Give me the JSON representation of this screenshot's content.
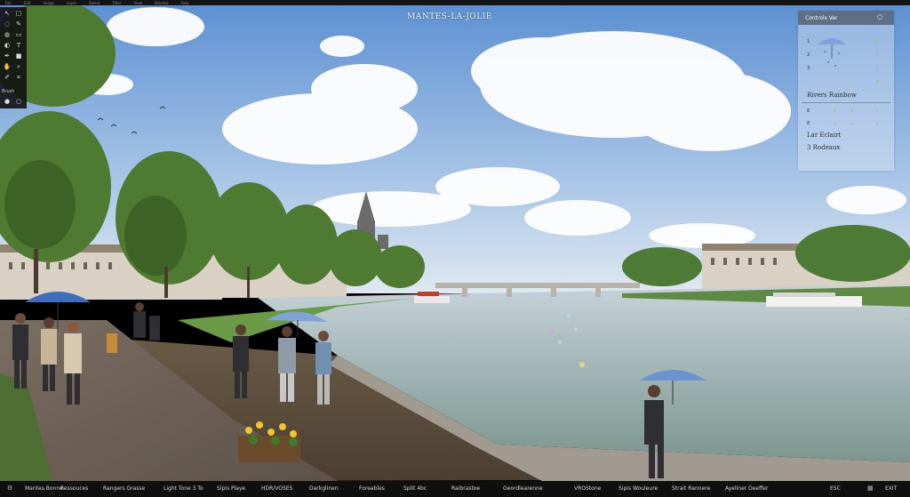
{
  "window": {
    "title": "MANTES-LA-JOLIE"
  },
  "top_menu": {
    "items": [
      "File",
      "Edit",
      "Image",
      "Layer",
      "Select",
      "Filter",
      "View",
      "Window",
      "Help"
    ]
  },
  "toolbox": {
    "label": "Brush"
  },
  "panel": {
    "title": "Controls Ver",
    "rows": [
      {
        "label": "1"
      },
      {
        "label": "2"
      },
      {
        "label": "3"
      }
    ],
    "section1": "Rivers Rainbow",
    "rows2": [
      {
        "label": "8"
      },
      {
        "label": "8"
      }
    ],
    "section2": "Lar Eclairt",
    "section3": "3 Rodeaux"
  },
  "bottom_bar": {
    "items": [
      {
        "label": "Mantes Bonne"
      },
      {
        "label": "Ressouces"
      },
      {
        "label": "Rangers Grasse"
      },
      {
        "label": "Light Tone 3 To"
      },
      {
        "label": "Sipis Playe"
      },
      {
        "label": "HDR/VOSES"
      },
      {
        "label": "Darkglinen"
      },
      {
        "label": "Foreables"
      },
      {
        "label": "Split 4bc"
      },
      {
        "label": "Raibrastoe"
      },
      {
        "label": "Geordlearenne"
      },
      {
        "label": "VROStone"
      },
      {
        "label": "Sipis Wouleure"
      },
      {
        "label": "Strait Rannere"
      },
      {
        "label": "Ayeliner Deeffer"
      },
      {
        "label": "ESC"
      },
      {
        "label": "EXIT"
      }
    ]
  },
  "colors": {
    "sky": "#6f9dd6",
    "water": "#9fb7b5",
    "accent": "#c9b15a"
  }
}
